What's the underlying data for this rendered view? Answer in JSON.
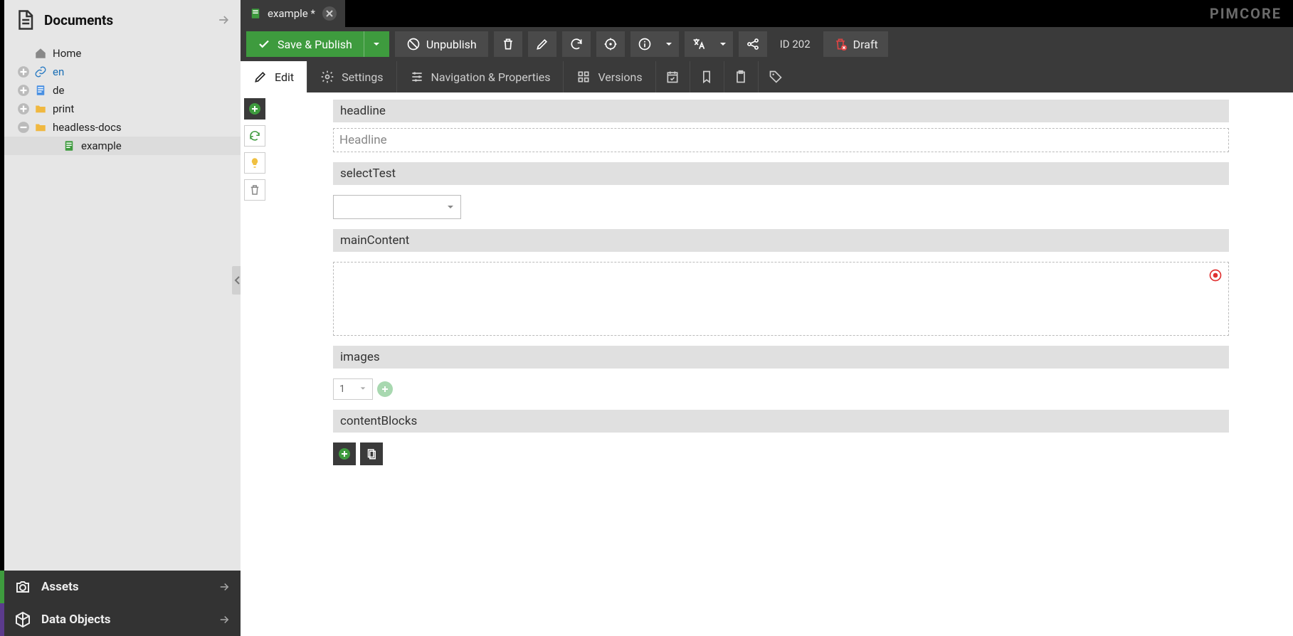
{
  "sidebar": {
    "documents_title": "Documents",
    "tree": {
      "home": "Home",
      "en": "en",
      "de": "de",
      "print": "print",
      "headless_docs": "headless-docs",
      "example": "example"
    },
    "assets_title": "Assets",
    "data_objects_title": "Data Objects"
  },
  "tab": {
    "label": "example *"
  },
  "brand": "PIMCORE",
  "toolbar1": {
    "save_publish": "Save & Publish",
    "unpublish": "Unpublish",
    "id_label": "ID 202",
    "draft": "Draft"
  },
  "toolbar2": {
    "edit": "Edit",
    "settings": "Settings",
    "nav_props": "Navigation & Properties",
    "versions": "Versions"
  },
  "editor": {
    "fields": {
      "headline_label": "headline",
      "headline_placeholder": "Headline",
      "selecttest_label": "selectTest",
      "maincontent_label": "mainContent",
      "images_label": "images",
      "images_count": "1",
      "contentblocks_label": "contentBlocks"
    }
  }
}
